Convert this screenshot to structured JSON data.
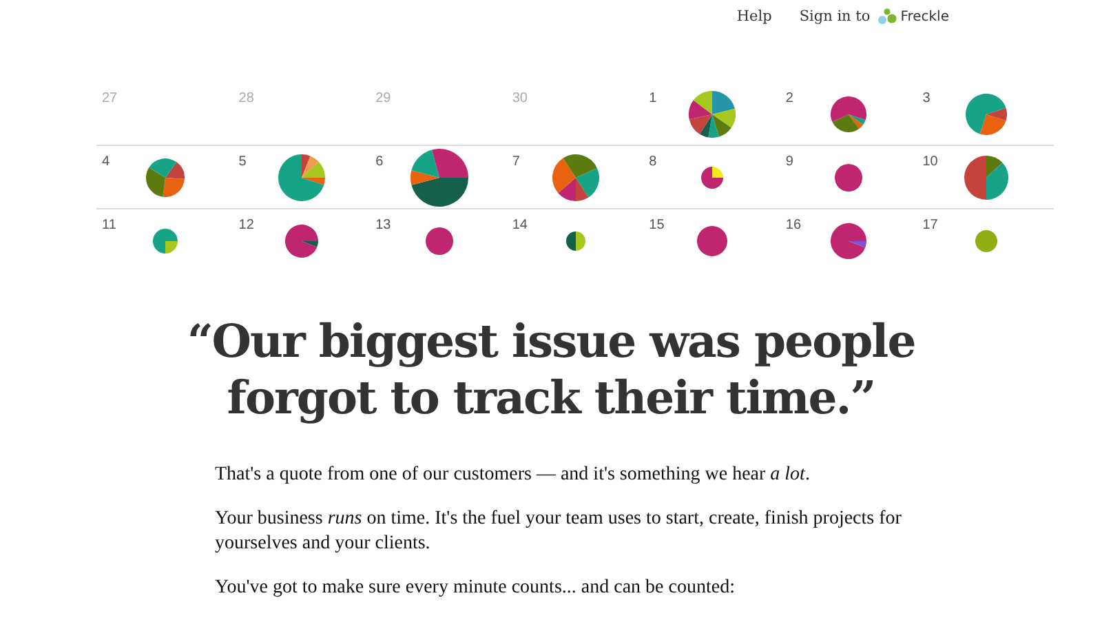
{
  "nav": {
    "help": "Help",
    "sign_in": "Sign in to",
    "brand": "Freckle"
  },
  "calendar": {
    "days": [
      {
        "day": "27",
        "current_month": false
      },
      {
        "day": "28",
        "current_month": false
      },
      {
        "day": "29",
        "current_month": false
      },
      {
        "day": "30",
        "current_month": false
      },
      {
        "day": "1",
        "current_month": true
      },
      {
        "day": "2",
        "current_month": true
      },
      {
        "day": "3",
        "current_month": true
      },
      {
        "day": "4",
        "current_month": true
      },
      {
        "day": "5",
        "current_month": true
      },
      {
        "day": "6",
        "current_month": true
      },
      {
        "day": "7",
        "current_month": true
      },
      {
        "day": "8",
        "current_month": true
      },
      {
        "day": "9",
        "current_month": true
      },
      {
        "day": "10",
        "current_month": true
      },
      {
        "day": "11",
        "current_month": true
      },
      {
        "day": "12",
        "current_month": true
      },
      {
        "day": "13",
        "current_month": true
      },
      {
        "day": "14",
        "current_month": true
      },
      {
        "day": "15",
        "current_month": true
      },
      {
        "day": "16",
        "current_month": true
      },
      {
        "day": "17",
        "current_month": true
      }
    ]
  },
  "quote": "“Our biggest issue was people forgot to track their time.”",
  "paragraphs": [
    "That's a quote from one of our customers — and it's something we hear *a lot*.",
    "Your business *runs* on time. It's the fuel your team uses to start, create, finish projects for yourselves and your clients.",
    "You've got to make sure every minute counts... and can be counted:"
  ]
}
